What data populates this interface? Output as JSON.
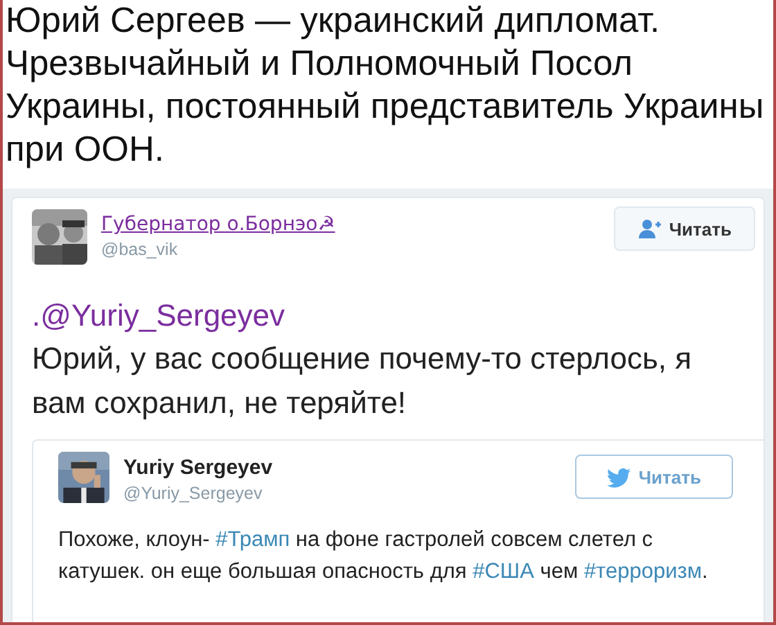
{
  "caption": "Юрий Сергеев — украинский дипломат. Чрезвычайный и Полномочный Посол Украины, постоянный представитель Украины при ООН.",
  "tweet": {
    "author": {
      "name": "Губернатор о.Борнэо☭",
      "handle": "@bas_vik"
    },
    "follow_button": {
      "label": "Читать",
      "kind": "person"
    },
    "mention": ".@Yuriy_Sergeyev",
    "text": "Юрий, у вас сообщение почему-то стерлось, я вам сохранил, не теряйте!",
    "quoted_tweet": {
      "author": {
        "name": "Yuriy Sergeyev",
        "handle": "@Yuriy_Sergeyev"
      },
      "follow_button": {
        "label": "Читать",
        "kind": "bird"
      },
      "text_parts": [
        {
          "text": "Похоже, клоун- ",
          "kind": "plain"
        },
        {
          "text": "#Трамп",
          "kind": "hashtag"
        },
        {
          "text": " на фоне гастролей совсем слетел с катушек. он еще большая опасность для ",
          "kind": "plain"
        },
        {
          "text": "#США",
          "kind": "hashtag"
        },
        {
          "text": " чем ",
          "kind": "plain"
        },
        {
          "text": "#терроризм",
          "kind": "hashtag"
        },
        {
          "text": ".",
          "kind": "plain"
        }
      ]
    }
  }
}
